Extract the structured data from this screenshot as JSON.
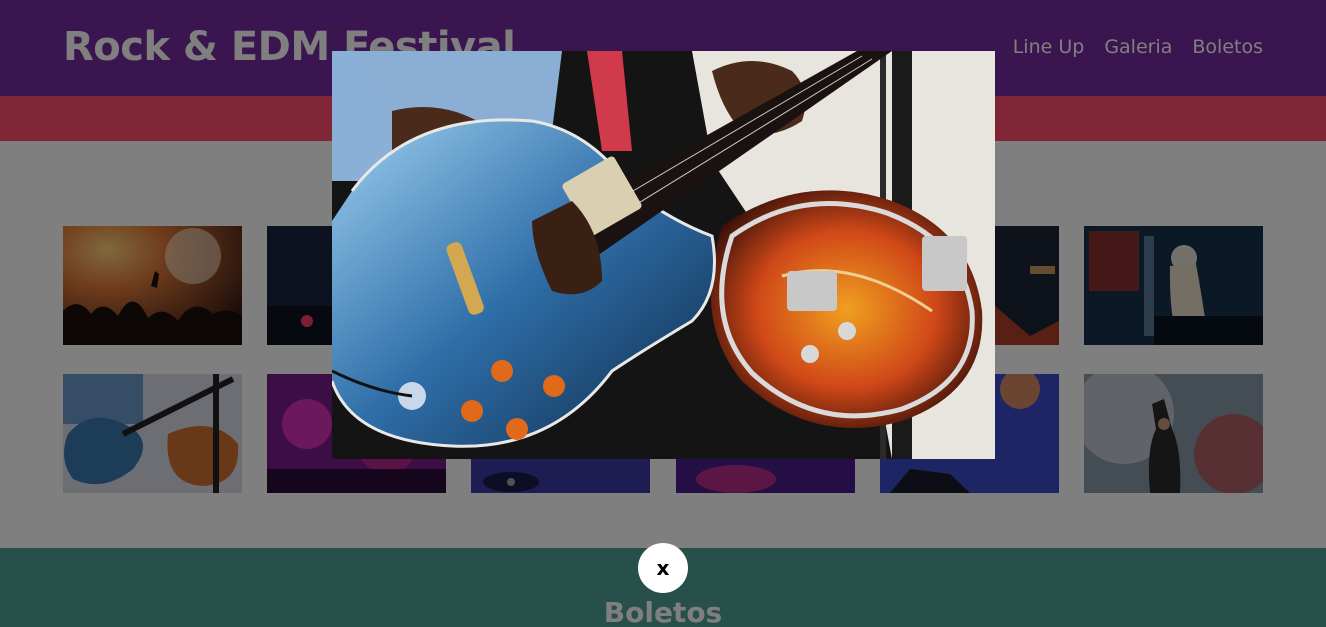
{
  "header": {
    "title": "Rock & EDM Festival",
    "nav": [
      {
        "label": "Line Up"
      },
      {
        "label": "Galeria"
      },
      {
        "label": "Boletos"
      }
    ]
  },
  "gallery": {
    "images": [
      {
        "icon": "concert-crowd-image"
      },
      {
        "icon": "dj-booth-image"
      },
      {
        "icon": "concert-image"
      },
      {
        "icon": "concert-image"
      },
      {
        "icon": "guitarist-image"
      },
      {
        "icon": "dj-woman-image"
      },
      {
        "icon": "guitar-closeup-image"
      },
      {
        "icon": "club-lights-image"
      },
      {
        "icon": "dj-turntables-image"
      },
      {
        "icon": "dj-turntables-image"
      },
      {
        "icon": "guitar-performer-image"
      },
      {
        "icon": "singer-smoke-image"
      }
    ]
  },
  "footer": {
    "title": "Boletos"
  },
  "lightbox": {
    "icon": "guitar-closeup-image",
    "close_label": "x"
  },
  "colors": {
    "header": "#752ba0",
    "band": "#fe4b6b",
    "footer": "#4fa095"
  }
}
